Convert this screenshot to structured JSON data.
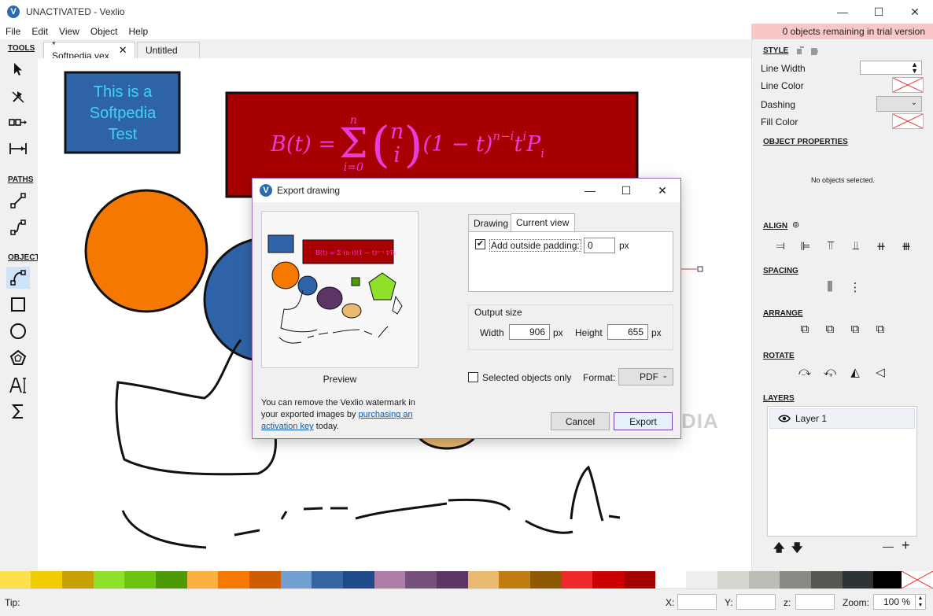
{
  "window": {
    "title": "UNACTIVATED - Vexlio",
    "logo_letter": "V",
    "minimize": "—",
    "maximize": "☐",
    "close": "✕"
  },
  "menu": [
    "File",
    "Edit",
    "View",
    "Object",
    "Help"
  ],
  "trial_notice": "0 objects remaining in trial version",
  "tools": {
    "headings": {
      "tools": "TOOLS",
      "paths": "PATHS",
      "objects": "OBJECTS"
    }
  },
  "tabs": [
    {
      "label": "* Softpedia.vex",
      "close": "✕",
      "active": true
    },
    {
      "label": "Untitled",
      "active": false
    }
  ],
  "canvas": {
    "text_box": [
      "This is a",
      "Softpedia",
      "Test"
    ],
    "formula": "B(t) = Σ (n i) (1 − t)ⁿ⁻ⁱ tⁱ Pᵢ",
    "formula_parts": {
      "lhs": "B(t) =",
      "sum_top": "n",
      "sum_bot": "i=0",
      "binom_top": "n",
      "binom_bot": "i",
      "rest": "(1 − t)",
      "exp1": "n−i",
      "t": "t",
      "exp2": "i",
      "p": "P",
      "sub": "i"
    },
    "watermark": "SOFTPEDIA"
  },
  "right_panel": {
    "style_head": "STYLE",
    "line_width": "Line Width",
    "line_color": "Line Color",
    "dashing": "Dashing",
    "fill_color": "Fill Color",
    "object_props": "OBJECT PROPERTIES",
    "no_objects": "No objects selected.",
    "align": "ALIGN",
    "spacing": "SPACING",
    "arrange": "ARRANGE",
    "rotate": "ROTATE",
    "layers": "LAYERS",
    "layer_name": "Layer 1",
    "up_arrow": "🡅",
    "down_arrow": "🡇",
    "minus": "—",
    "plus": "+"
  },
  "palette": [
    "#fcdf4c",
    "#f0cc00",
    "#c8a000",
    "#8fe02a",
    "#6cc50f",
    "#4e9a06",
    "#fbb040",
    "#f57900",
    "#ce5c00",
    "#729fcf",
    "#3465a4",
    "#204a87",
    "#ad7fa8",
    "#75507b",
    "#5c3566",
    "#e9b96e",
    "#c17d11",
    "#8f5902",
    "#ef2929",
    "#cc0000",
    "#a40000",
    "#ffffff",
    "#eeeeec",
    "#d3d7cf",
    "#babdb6",
    "#888a85",
    "#555753",
    "#2e3436",
    "#000000"
  ],
  "status": {
    "tip": "Tip:",
    "x": "X:",
    "y": "Y:",
    "z": "z:",
    "zoom_label": "Zoom:",
    "zoom_value": "100 %"
  },
  "dialog": {
    "title": "Export drawing",
    "minimize": "—",
    "maximize": "☐",
    "close": "✕",
    "preview_label": "Preview",
    "note_before": "You can remove the Vexlio watermark in your exported images by ",
    "note_link": "purchasing an activation key",
    "note_after": " today.",
    "tab_drawing": "Drawing",
    "tab_current": "Current view",
    "padding_label": "Add outside padding:",
    "padding_checked": true,
    "padding_value": "0",
    "px": "px",
    "output_size": "Output size",
    "width_label": "Width",
    "width_value": "906",
    "height_label": "Height",
    "height_value": "655",
    "selected_only": "Selected objects only",
    "format_label": "Format:",
    "format_value": "PDF",
    "cancel": "Cancel",
    "export": "Export"
  }
}
